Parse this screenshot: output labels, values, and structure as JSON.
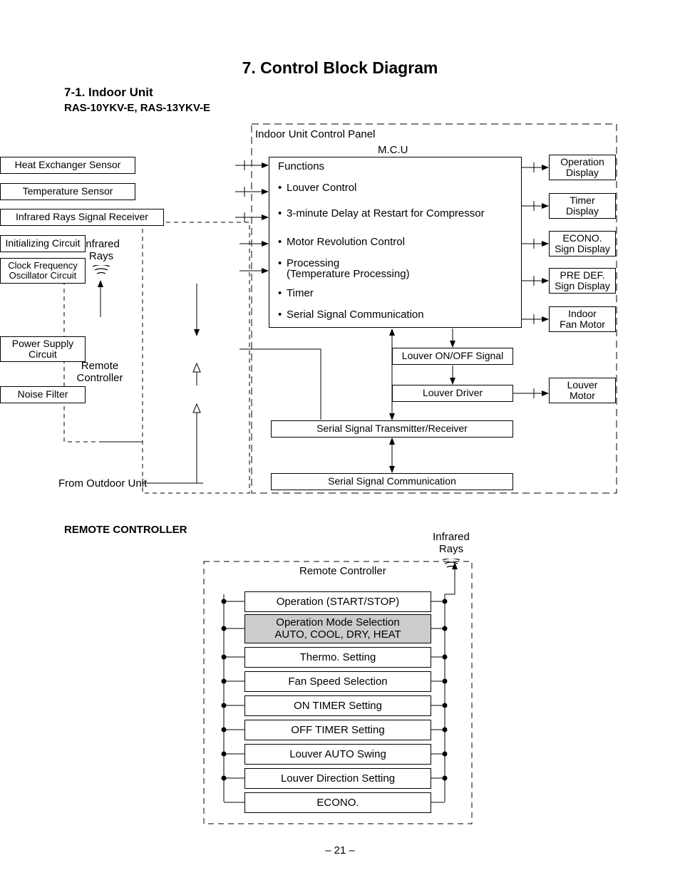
{
  "title": "7.  Control Block Diagram",
  "section": "7-1.  Indoor Unit",
  "models": "RAS-10YKV-E, RAS-13YKV-E",
  "panel_label": "Indoor Unit Control Panel",
  "mcu_label": "M.C.U",
  "left_boxes": {
    "heat_exchanger": "Heat Exchanger Sensor",
    "temperature_sensor": "Temperature Sensor",
    "ir_receiver": "Infrared Rays Signal Receiver",
    "initializing": "Initializing Circuit",
    "clock_freq": "Clock Frequency Oscillator Circuit",
    "power_supply": "Power Supply Circuit",
    "noise_filter": "Noise Filter"
  },
  "infrared_label": "Infrared Rays",
  "remote_controller_label": "Remote Controller",
  "from_outdoor_label": "From Outdoor Unit",
  "functions_label": "Functions",
  "functions": [
    "Louver Control",
    "3-minute Delay at Restart for Compressor",
    "Motor Revolution Control",
    "Processing\n(Temperature Processing)",
    "Timer",
    "Serial Signal Communication"
  ],
  "right_boxes": {
    "operation_display": "Operation Display",
    "timer_display": "Timer Display",
    "econo_display": "ECONO. Sign Display",
    "predef_display": "PRE DEF. Sign Display",
    "indoor_fan_motor": "Indoor Fan Motor",
    "louver_motor": "Louver Motor"
  },
  "louver_signal": "Louver ON/OFF Signal",
  "louver_driver": "Louver Driver",
  "serial_tx_rx": "Serial Signal Transmitter/Receiver",
  "serial_comm": "Serial Signal Communication",
  "rc_heading": "REMOTE CONTROLLER",
  "rc_title": "Remote Controller",
  "rc_ir_label": "Infrared Rays",
  "rc_items": {
    "op_start_stop": "Operation (START/STOP)",
    "op_mode_l1": "Operation Mode Selection",
    "op_mode_l2": "AUTO, COOL, DRY, HEAT",
    "thermo": "Thermo. Setting",
    "fan_speed": "Fan Speed Selection",
    "on_timer": "ON TIMER Setting",
    "off_timer": "OFF TIMER Setting",
    "louver_auto": "Louver AUTO Swing",
    "louver_dir": "Louver Direction Setting",
    "econo": "ECONO."
  },
  "page_number": "– 21 –"
}
